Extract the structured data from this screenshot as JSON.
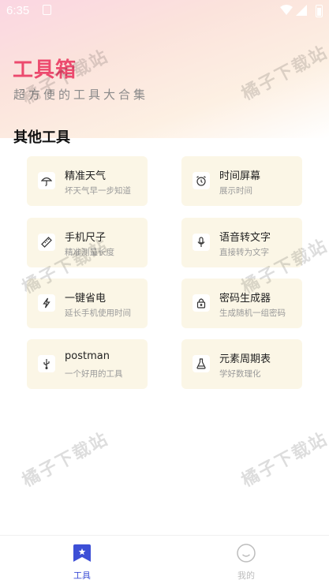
{
  "status_bar": {
    "time": "6:35"
  },
  "header": {
    "title": "工具箱",
    "subtitle": "超方便的工具大合集"
  },
  "section": {
    "title": "其他工具"
  },
  "tools": [
    {
      "name": "精准天气",
      "desc": "坏天气早一步知道",
      "icon": "umbrella-icon"
    },
    {
      "name": "时间屏幕",
      "desc": "展示时间",
      "icon": "alarm-clock-icon"
    },
    {
      "name": "手机尺子",
      "desc": "精准测量长度",
      "icon": "ruler-icon"
    },
    {
      "name": "语音转文字",
      "desc": "直接转为文字",
      "icon": "microphone-icon"
    },
    {
      "name": "一键省电",
      "desc": "延长手机使用时间",
      "icon": "lightning-icon"
    },
    {
      "name": "密码生成器",
      "desc": "生成随机一组密码",
      "icon": "lock-icon"
    },
    {
      "name": "postman",
      "desc": "一个好用的工具",
      "icon": "usb-icon"
    },
    {
      "name": "元素周期表",
      "desc": "学好数理化",
      "icon": "flask-icon"
    }
  ],
  "watermark": "橘子下载站",
  "tabbar": {
    "tools_label": "工具",
    "mine_label": "我的",
    "active_color": "#3d4fd6",
    "inactive_color": "#bdbdbd"
  },
  "colors": {
    "brand": "#ec4a6e",
    "card_bg": "#fbf6e6"
  }
}
